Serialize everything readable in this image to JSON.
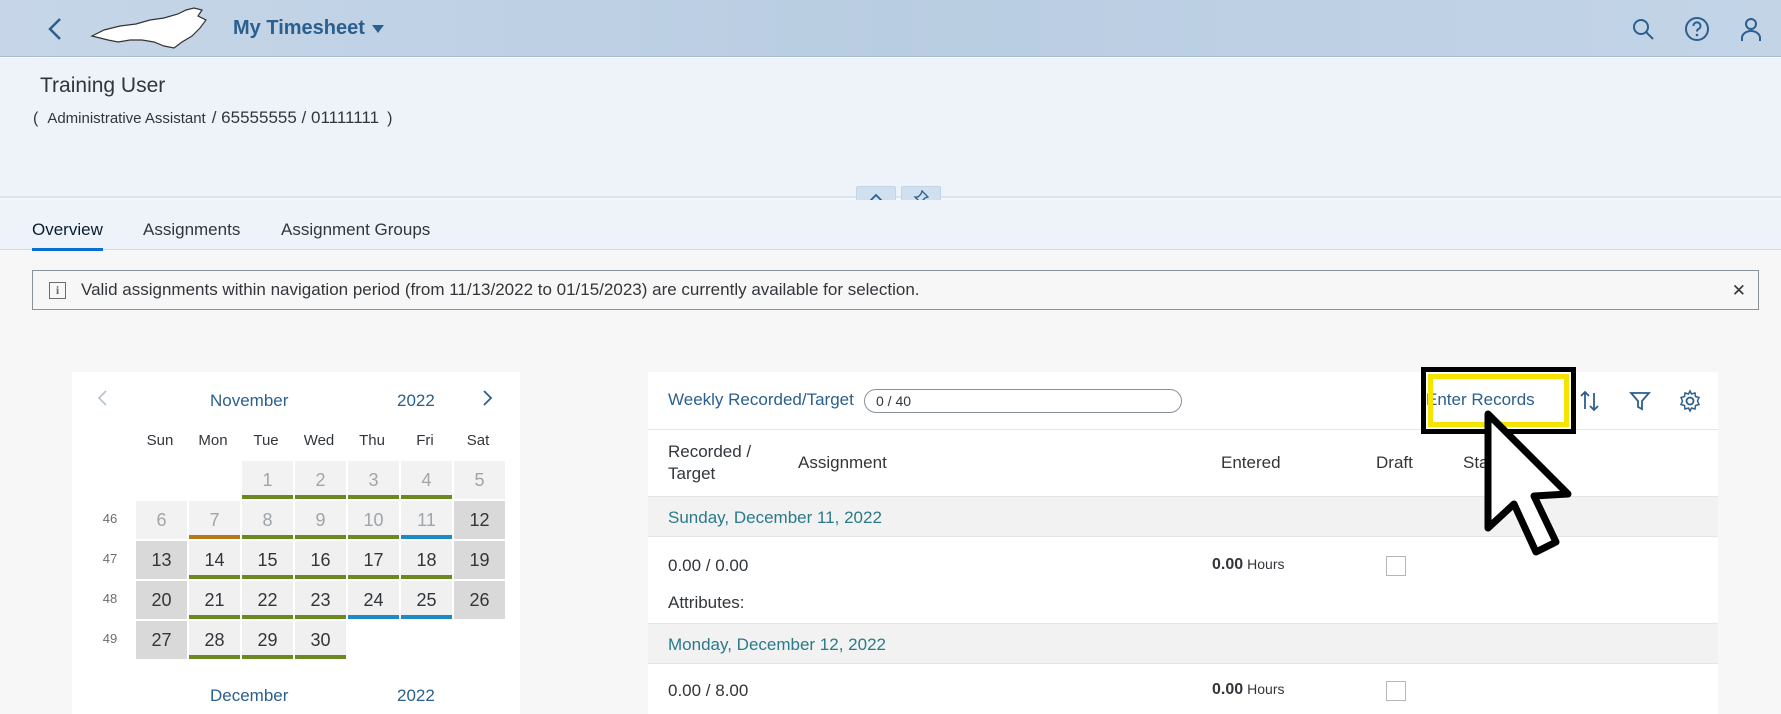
{
  "shell": {
    "title": "My Timesheet"
  },
  "header": {
    "name": "Training User",
    "paren_open": "(",
    "role": "Administrative Assistant",
    "ids": "/ 65555555 / 01111111",
    "paren_close": ")"
  },
  "tabs": [
    {
      "label": "Overview",
      "active": true
    },
    {
      "label": "Assignments",
      "active": false
    },
    {
      "label": "Assignment Groups",
      "active": false
    }
  ],
  "message": {
    "text": "Valid assignments within navigation period (from 11/13/2022 to 01/15/2023) are currently available for selection.",
    "close": "✕"
  },
  "calendar": {
    "month": "November",
    "year": "2022",
    "weekdays": [
      "Sun",
      "Mon",
      "Tue",
      "Wed",
      "Thu",
      "Fri",
      "Sat"
    ],
    "weeks": [
      "46",
      "47",
      "48",
      "49"
    ],
    "next_month": "December",
    "next_year": "2022",
    "status_colors": {
      "complete": "#6a8a1f",
      "partial": "#b5771a",
      "info": "#1b8ac6"
    },
    "days_row1": [
      "1",
      "2",
      "3",
      "4",
      "5"
    ],
    "days_row2": [
      "6",
      "7",
      "8",
      "9",
      "10",
      "11",
      "12"
    ],
    "days_row3": [
      "13",
      "14",
      "15",
      "16",
      "17",
      "18",
      "19"
    ],
    "days_row4": [
      "20",
      "21",
      "22",
      "23",
      "24",
      "25",
      "26"
    ],
    "days_row5": [
      "27",
      "28",
      "29",
      "30"
    ]
  },
  "table": {
    "weekly_label": "Weekly Recorded/Target",
    "progress": "0 / 40",
    "progress_fraction": 0,
    "enter_records": "Enter Records",
    "columns": {
      "recorded": "Recorded /",
      "target": "Target",
      "assignment": "Assignment",
      "entered": "Entered",
      "draft": "Draft",
      "status": "Sta"
    },
    "groups": [
      {
        "date": "Sunday, December 11, 2022",
        "recorded": "0.00 / 0.00",
        "entered": "0.00",
        "unit": "Hours",
        "attributes": "Attributes:"
      },
      {
        "date": "Monday, December 12, 2022",
        "recorded": "0.00 / 8.00",
        "entered": "0.00",
        "unit": "Hours"
      }
    ]
  }
}
